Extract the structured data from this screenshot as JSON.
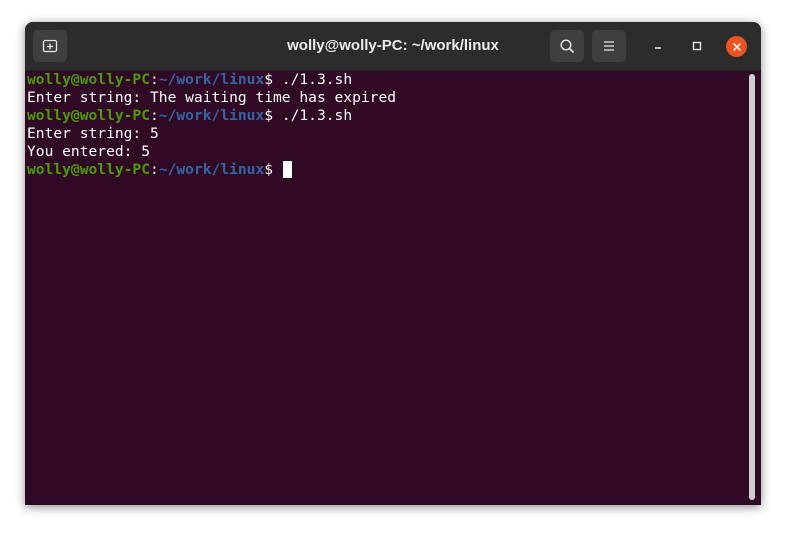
{
  "window": {
    "title": "wolly@wolly-PC: ~/work/linux"
  },
  "icons": {
    "new_tab": "new-tab-icon",
    "search": "search-icon",
    "menu": "hamburger-menu-icon",
    "minimize": "minimize-icon",
    "maximize": "maximize-icon",
    "close": "close-icon"
  },
  "colors": {
    "terminal_bg": "#300a24",
    "prompt_user": "#4e9a06",
    "prompt_path": "#3465a4",
    "close_button": "#e95420"
  },
  "terminal": {
    "lines": [
      {
        "user": "wolly@wolly-PC",
        "sep": ":",
        "path": "~/work/linux",
        "prompt": "$ ",
        "command": "./1.3.sh"
      },
      {
        "text": "Enter string: The waiting time has expired"
      },
      {
        "user": "wolly@wolly-PC",
        "sep": ":",
        "path": "~/work/linux",
        "prompt": "$ ",
        "command": "./1.3.sh"
      },
      {
        "text": "Enter string: 5"
      },
      {
        "text": "You entered: 5"
      },
      {
        "user": "wolly@wolly-PC",
        "sep": ":",
        "path": "~/work/linux",
        "prompt": "$ ",
        "command": ""
      }
    ]
  }
}
